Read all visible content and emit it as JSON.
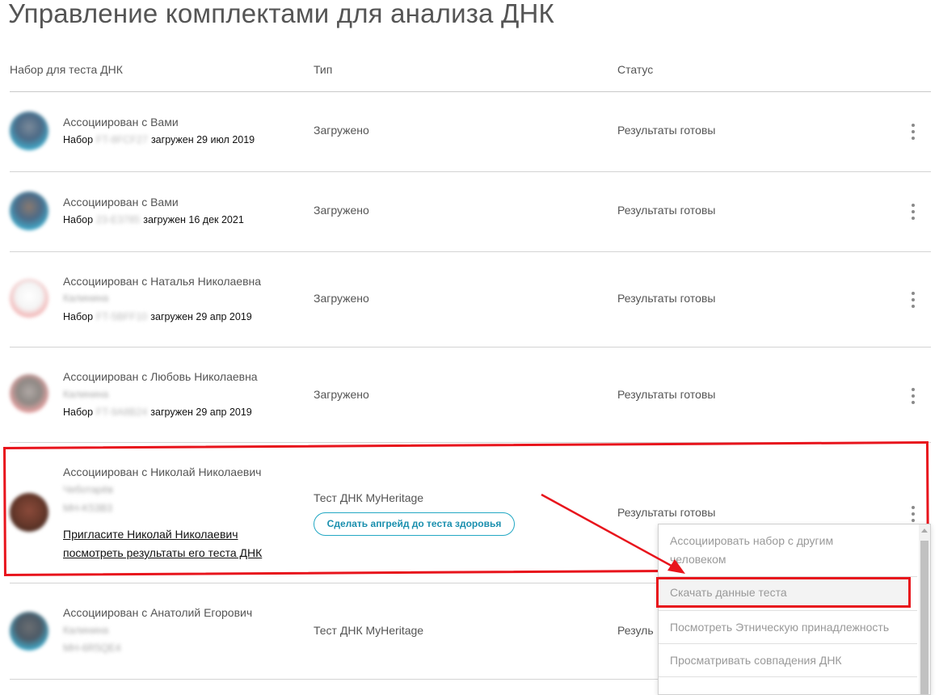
{
  "page": {
    "title": "Управление комплектами для анализа ДНК"
  },
  "columns": {
    "kit": "Набор для теста ДНК",
    "type": "Тип",
    "status": "Статус"
  },
  "kits": [
    {
      "associated": "Ассоциирован с Вами",
      "kit_prefix": "Набор",
      "kit_code": "FT-8FCF27",
      "uploaded": "загружен 29 июл 2019",
      "type": "Загружено",
      "status": "Результаты готовы"
    },
    {
      "associated": "Ассоциирован с Вами",
      "kit_prefix": "Набор",
      "kit_code": "23-E3785",
      "uploaded": "загружен 16 дек 2021",
      "type": "Загружено",
      "status": "Результаты готовы"
    },
    {
      "associated": "Ассоциирован с Наталья Николаевна",
      "surname": "Калинина",
      "kit_prefix": "Набор",
      "kit_code": "FT-5BFF10",
      "uploaded": "загружен 29 апр 2019",
      "type": "Загружено",
      "status": "Результаты готовы"
    },
    {
      "associated": "Ассоциирован с Любовь Николаевна",
      "surname": "Калинина",
      "kit_prefix": "Набор",
      "kit_code": "FT-9A8B24",
      "uploaded": "загружен 29 апр 2019",
      "type": "Загружено",
      "status": "Результаты готовы"
    },
    {
      "associated": "Ассоциирован с Николай Николаевич",
      "surname": "Чеботарёв",
      "kit_code": "MH-K53B3",
      "invite_line1": "Пригласите Николай Николаевич",
      "invite_line2": "посмотреть результаты его теста ДНК",
      "type": "Тест ДНК MyHeritage",
      "upgrade_label": "Сделать апгрейд до теста здоровья",
      "status": "Результаты готовы"
    },
    {
      "associated": "Ассоциирован с Анатолий Егорович",
      "surname": "Калинина",
      "kit_code": "MH-6R5QE4",
      "type": "Тест ДНК MyHeritage",
      "status": "Резуль"
    }
  ],
  "context_menu": {
    "items": [
      {
        "line1": "Ассоциировать набор с другим",
        "line2": "человеком"
      },
      {
        "line1": "Скачать данные теста"
      },
      {
        "line1": "Посмотреть Этническую принадлежность"
      },
      {
        "line1": "Просматривать совпадения ДНК"
      }
    ]
  },
  "colors": {
    "highlight": "#e8141c",
    "accent": "#1a8fae"
  }
}
